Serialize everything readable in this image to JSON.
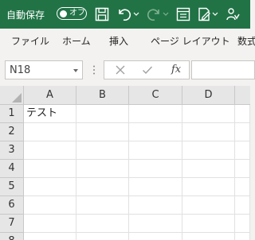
{
  "titlebar": {
    "autosave_label": "自動保存",
    "autosave_state": "オフ"
  },
  "ribbon": {
    "tabs": [
      "ファイル",
      "ホーム",
      "挿入",
      "ページ レイアウト",
      "数式"
    ]
  },
  "formula_bar": {
    "name_box": "N18",
    "fx_label": "fx",
    "value": ""
  },
  "sheet": {
    "columns": [
      "A",
      "B",
      "C",
      "D"
    ],
    "rows": [
      "1",
      "2",
      "3",
      "4",
      "5",
      "6",
      "7",
      "8"
    ],
    "cells": {
      "A1": "テスト"
    }
  },
  "colors": {
    "accent": "#217346",
    "header_bg": "#e6e6e6",
    "gridline": "#e1e1e1"
  }
}
